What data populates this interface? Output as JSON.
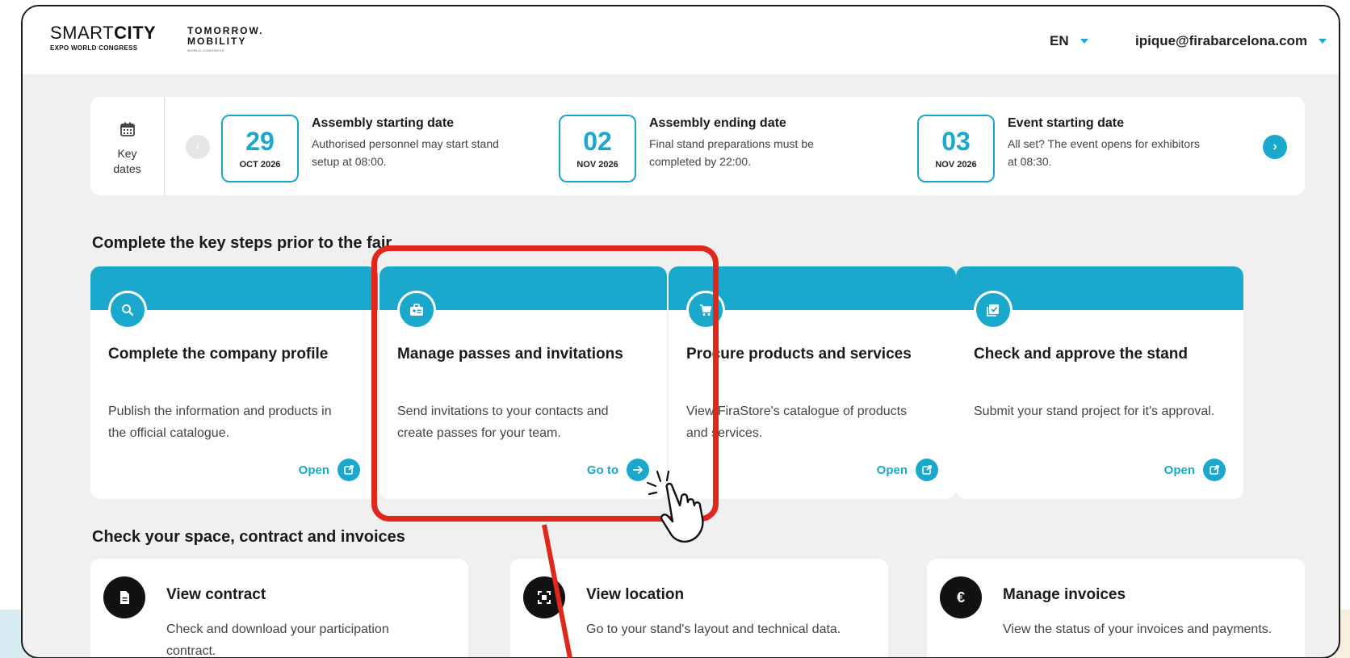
{
  "header": {
    "logo_smartcity_light": "SMART",
    "logo_smartcity_bold": "CITY",
    "logo_smartcity_sub": "EXPO WORLD CONGRESS",
    "logo_tomorrow_line1": "TOMORROW.",
    "logo_tomorrow_line2": "MOBILITY",
    "logo_tomorrow_sub": "WORLD CONGRESS",
    "language": "EN",
    "user_email": "ipique@firabarcelona.com"
  },
  "key_dates": {
    "label_line1": "Key",
    "label_line2": "dates",
    "items": [
      {
        "day": "29",
        "month": "OCT 2026",
        "title": "Assembly starting date",
        "desc": "Authorised personnel may start stand setup at 08:00."
      },
      {
        "day": "02",
        "month": "NOV 2026",
        "title": "Assembly ending date",
        "desc": "Final stand preparations must be completed by 22:00."
      },
      {
        "day": "03",
        "month": "NOV 2026",
        "title": "Event starting date",
        "desc": "All set? The event opens for exhibitors at 08:30."
      }
    ]
  },
  "steps": {
    "heading": "Complete the key steps prior to the fair",
    "cards": [
      {
        "icon": "search-icon",
        "title": "Complete the company profile",
        "desc": "Publish the information and products in the official catalogue.",
        "action": "Open"
      },
      {
        "icon": "badge-icon",
        "title": "Manage passes and invitations",
        "desc": "Send invitations to your contacts and create passes for your team.",
        "action": "Go to"
      },
      {
        "icon": "cart-icon",
        "title": "Procure products and services",
        "desc": "View FiraStore's catalogue of products and services.",
        "action": "Open"
      },
      {
        "icon": "checklist-icon",
        "title": "Check and approve the stand",
        "desc": "Submit your stand project for it's approval.",
        "action": "Open"
      }
    ]
  },
  "space": {
    "heading": "Check your space, contract and invoices",
    "cards": [
      {
        "icon": "document-icon",
        "title": "View contract",
        "desc": "Check and download your participation contract."
      },
      {
        "icon": "location-frame-icon",
        "title": "View location",
        "desc": "Go to your stand's layout and technical data."
      },
      {
        "icon": "euro-icon",
        "title": "Manage invoices",
        "desc": "View the status of your invoices and payments."
      }
    ]
  },
  "colors": {
    "accent": "#1aa8cc",
    "highlight": "#e1261c",
    "background": "#f0f0f0"
  }
}
